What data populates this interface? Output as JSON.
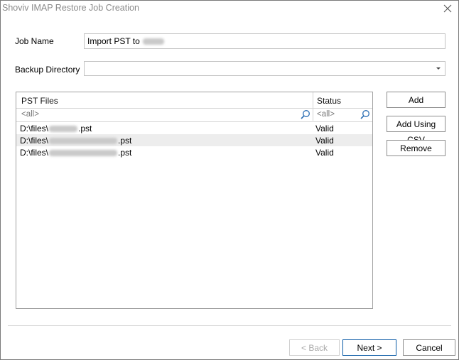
{
  "window": {
    "title": "Shoviv IMAP Restore Job Creation"
  },
  "form": {
    "job_name_label": "Job Name",
    "job_name_value": "Import PST to",
    "backup_dir_label": "Backup Directory",
    "backup_dir_value": ""
  },
  "grid": {
    "columns": [
      "PST Files",
      "Status"
    ],
    "filter_placeholder": "<all>",
    "rows": [
      {
        "prefix": "D:\\files\\",
        "suffix": ".pst",
        "status": "Valid"
      },
      {
        "prefix": "D:\\files\\",
        "suffix": ".pst",
        "status": "Valid"
      },
      {
        "prefix": "D:\\files\\",
        "suffix": ".pst",
        "status": "Valid"
      }
    ]
  },
  "side_buttons": {
    "add": "Add",
    "add_csv": "Add Using CSV",
    "remove": "Remove"
  },
  "footer": {
    "back": "< Back",
    "next": "Next >",
    "cancel": "Cancel"
  },
  "icons": {
    "close": "close-icon",
    "dropdown": "dropdown-arrow-icon",
    "search": "search-icon"
  }
}
